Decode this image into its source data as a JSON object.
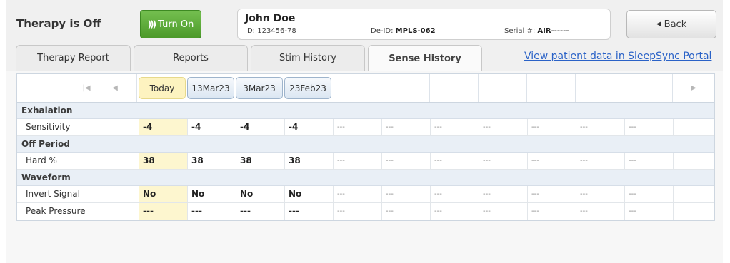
{
  "header": {
    "therapy_status": "Therapy is Off",
    "turn_on_label": "Turn On",
    "turn_on_icon": "signal-waves-icon",
    "patient": {
      "name": "John Doe",
      "id_label": "ID:",
      "id_value": "123456-78",
      "deid_label": "De-ID:",
      "deid_value": "MPLS-062",
      "serial_label": "Serial #:",
      "serial_value": "AIR------"
    },
    "back_label": "Back",
    "back_icon": "triangle-left-icon"
  },
  "tabs": [
    {
      "label": "Therapy Report",
      "active": false
    },
    {
      "label": "Reports",
      "active": false
    },
    {
      "label": "Stim History",
      "active": false
    },
    {
      "label": "Sense History",
      "active": true
    }
  ],
  "portal_link": "View patient data in SleepSync Portal",
  "table": {
    "dates": [
      "Today",
      "13Mar23",
      "3Mar23",
      "23Feb23"
    ],
    "empty_placeholder": "---",
    "sections": [
      {
        "title": "Exhalation",
        "rows": [
          {
            "label": "Sensitivity",
            "values": [
              "-4",
              "-4",
              "-4",
              "-4"
            ]
          }
        ]
      },
      {
        "title": "Off Period",
        "rows": [
          {
            "label": "Hard %",
            "values": [
              "38",
              "38",
              "38",
              "38"
            ]
          }
        ]
      },
      {
        "title": "Waveform",
        "rows": [
          {
            "label": "Invert Signal",
            "values": [
              "No",
              "No",
              "No",
              "No"
            ]
          },
          {
            "label": "Peak Pressure",
            "values": [
              "---",
              "---",
              "---",
              "---"
            ]
          }
        ]
      }
    ]
  },
  "colors": {
    "accent_green": "#5aa834",
    "link_blue": "#2a62c7",
    "today_highlight": "#fdf6cf"
  }
}
